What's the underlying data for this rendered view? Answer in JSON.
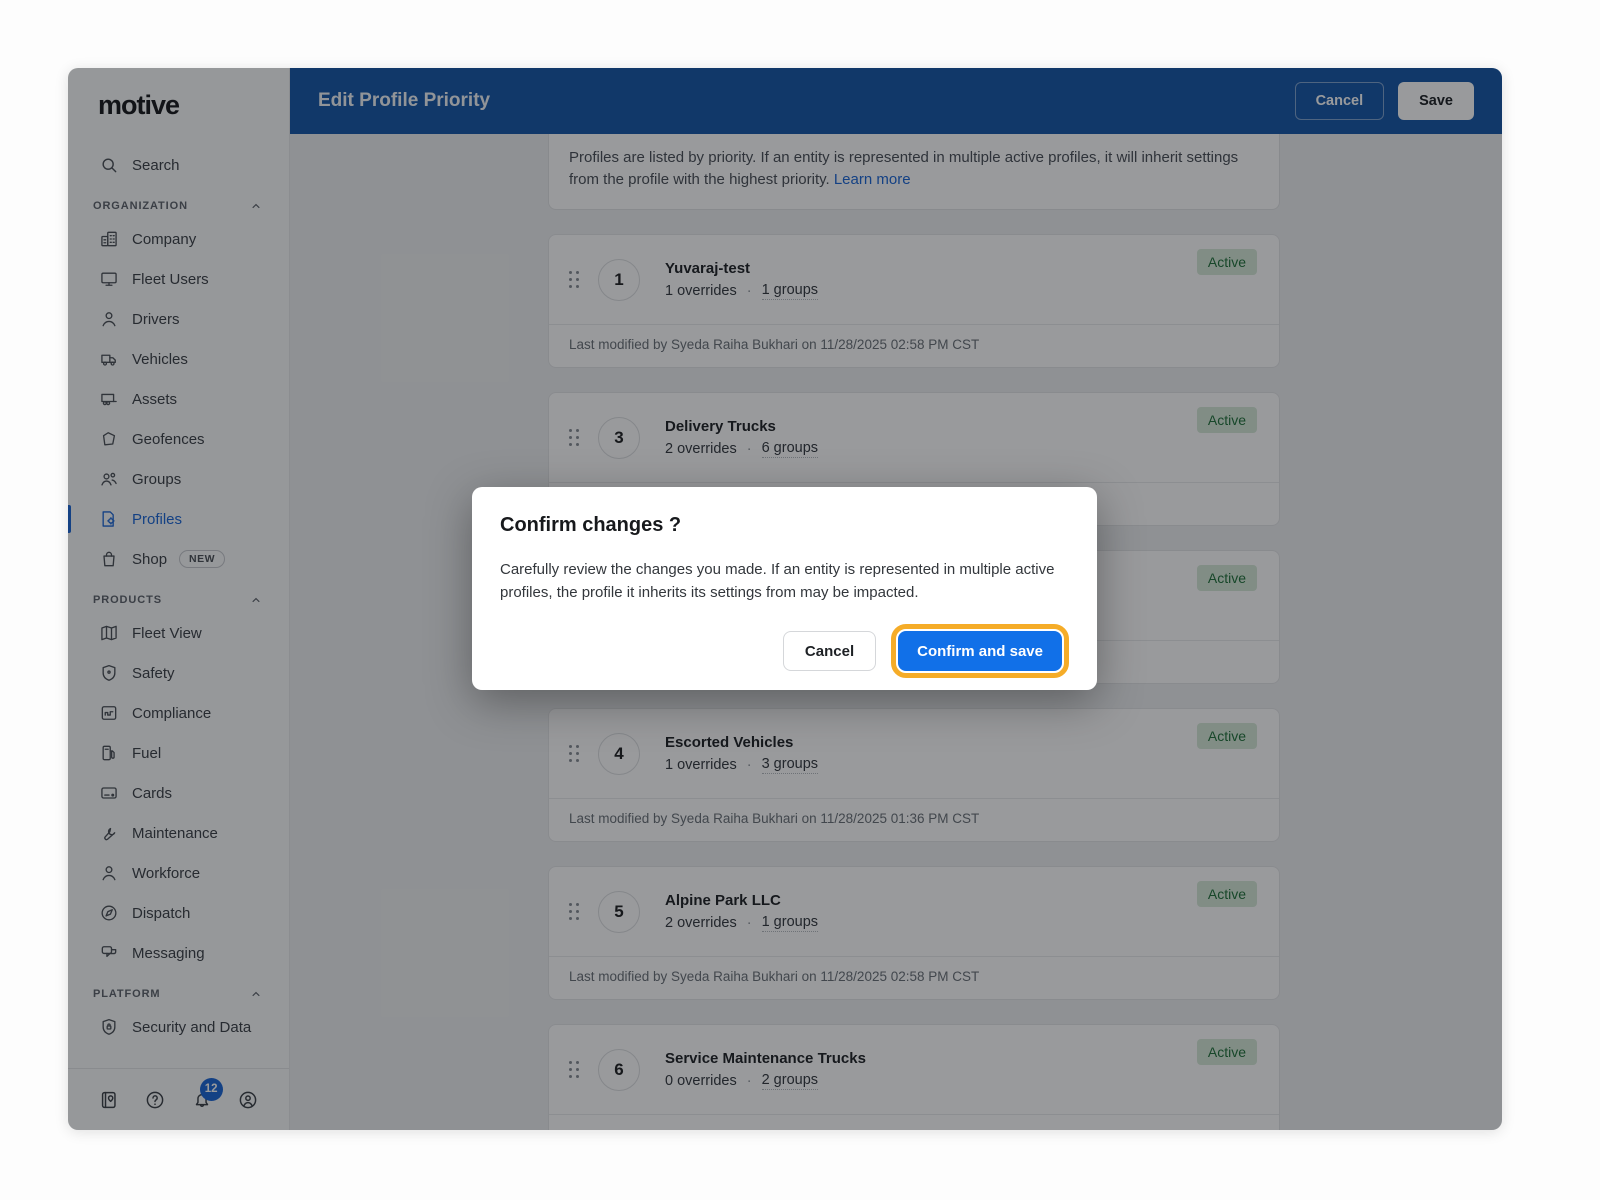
{
  "sidebar": {
    "logo": "motive",
    "search": {
      "label": "Search",
      "icon": "search-icon"
    },
    "sections": [
      {
        "label": "ORGANIZATION",
        "chevron_icon": "chevron-up-icon",
        "items": [
          {
            "label": "Company",
            "icon": "company-icon"
          },
          {
            "label": "Fleet Users",
            "icon": "fleet-users-icon"
          },
          {
            "label": "Drivers",
            "icon": "drivers-icon"
          },
          {
            "label": "Vehicles",
            "icon": "vehicles-icon"
          },
          {
            "label": "Assets",
            "icon": "assets-icon"
          },
          {
            "label": "Geofences",
            "icon": "geofences-icon"
          },
          {
            "label": "Groups",
            "icon": "groups-icon"
          },
          {
            "label": "Profiles",
            "icon": "profiles-icon",
            "active": true
          },
          {
            "label": "Shop",
            "icon": "shop-icon",
            "badge": "NEW"
          }
        ]
      },
      {
        "label": "PRODUCTS",
        "chevron_icon": "chevron-up-icon",
        "items": [
          {
            "label": "Fleet View",
            "icon": "fleet-view-icon"
          },
          {
            "label": "Safety",
            "icon": "safety-shield-icon"
          },
          {
            "label": "Compliance",
            "icon": "compliance-icon"
          },
          {
            "label": "Fuel",
            "icon": "fuel-icon"
          },
          {
            "label": "Cards",
            "icon": "cards-icon"
          },
          {
            "label": "Maintenance",
            "icon": "maintenance-wrench-icon"
          },
          {
            "label": "Workforce",
            "icon": "workforce-icon"
          },
          {
            "label": "Dispatch",
            "icon": "dispatch-icon"
          },
          {
            "label": "Messaging",
            "icon": "messaging-icon"
          }
        ]
      },
      {
        "label": "PLATFORM",
        "chevron_icon": "chevron-up-icon",
        "items": [
          {
            "label": "Security and Data",
            "icon": "security-shield-lock-icon"
          }
        ]
      }
    ],
    "footer_icons": [
      {
        "icon": "logbook-icon"
      },
      {
        "icon": "help-icon"
      },
      {
        "icon": "notifications-bell-icon",
        "badge": "12"
      },
      {
        "icon": "account-icon"
      }
    ]
  },
  "header": {
    "title": "Edit Profile Priority",
    "cancel_label": "Cancel",
    "save_label": "Save"
  },
  "main": {
    "description": "Profiles are listed by priority. If an entity is represented in multiple active profiles, it will inherit settings from the profile with the highest priority. ",
    "learn_more_label": "Learn more",
    "cards": [
      {
        "priority": "1",
        "name": "Yuvaraj-test",
        "overrides": "1 overrides",
        "separator": "·",
        "groups": "1 groups",
        "status": "Active",
        "footer": "Last modified by Syeda Raiha Bukhari on 11/28/2025 02:58 PM CST"
      },
      {
        "priority": "3",
        "name": "Delivery Trucks",
        "overrides": "2 overrides",
        "separator": "·",
        "groups": "6 groups",
        "status": "Active",
        "footer": ""
      },
      {
        "priority": "",
        "name": "",
        "overrides": "",
        "separator": "",
        "groups": "",
        "status": "Active",
        "footer": ""
      },
      {
        "priority": "4",
        "name": "Escorted Vehicles",
        "overrides": "1 overrides",
        "separator": "·",
        "groups": "3 groups",
        "status": "Active",
        "footer": "Last modified by Syeda Raiha Bukhari on 11/28/2025 01:36 PM CST"
      },
      {
        "priority": "5",
        "name": "Alpine Park LLC",
        "overrides": "2 overrides",
        "separator": "·",
        "groups": "1 groups",
        "status": "Active",
        "footer": "Last modified by Syeda Raiha Bukhari on 11/28/2025 02:58 PM CST"
      },
      {
        "priority": "6",
        "name": "Service Maintenance Trucks",
        "overrides": "0 overrides",
        "separator": "·",
        "groups": "2 groups",
        "status": "Active",
        "footer": ""
      }
    ]
  },
  "modal": {
    "title": "Confirm changes ?",
    "body": "Carefully review the changes you made. If an entity is represented in multiple active profiles, the profile it inherits its settings from may be impacted.",
    "cancel_label": "Cancel",
    "confirm_label": "Confirm and save"
  },
  "colors": {
    "header_blue": "#1557a8",
    "accent_blue": "#1a66d6",
    "confirm_button_blue": "#1170e8",
    "highlight_ring_orange": "#f5ac28",
    "active_badge_bg": "#d6e9d8",
    "active_badge_text": "#20713a",
    "notification_badge_blue": "#1a66d6"
  }
}
